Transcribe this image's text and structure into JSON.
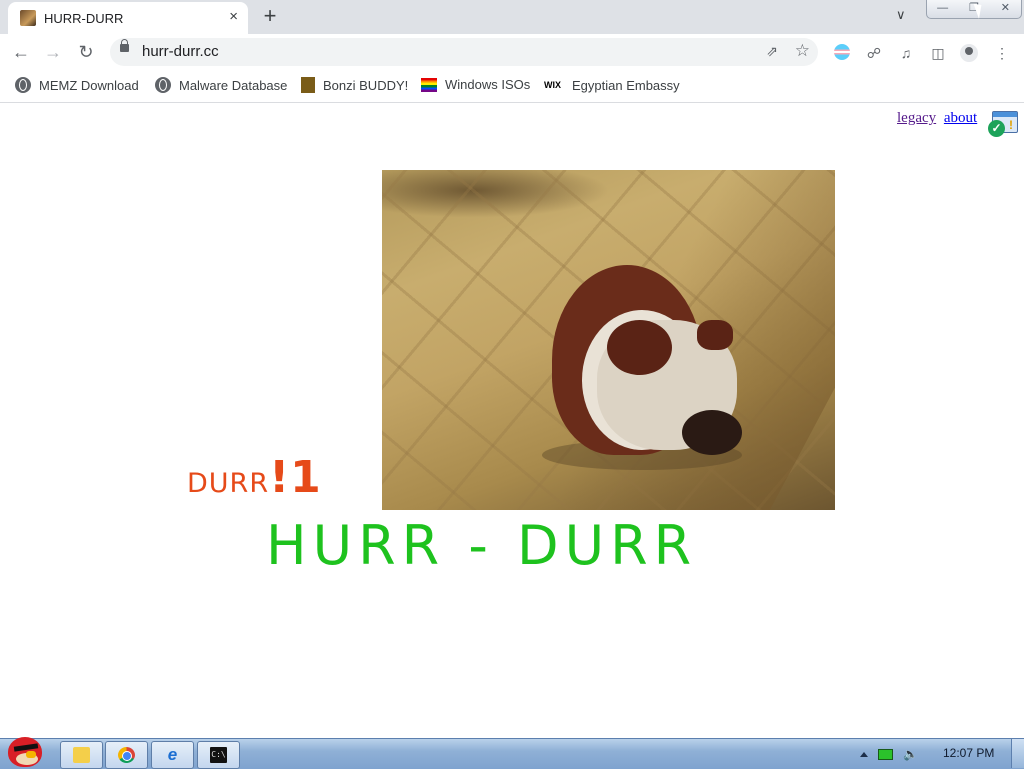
{
  "browser": {
    "tab": {
      "title": "HURR-DURR",
      "close_icon": "×"
    },
    "new_tab_icon": "+",
    "address": {
      "url": "hurr-durr.cc"
    },
    "bookmarks": [
      {
        "label": "MEMZ Download",
        "icon": "globe-icon"
      },
      {
        "label": "Malware Database",
        "icon": "globe-icon"
      },
      {
        "label": "Bonzi BUDDY!",
        "icon": "bonzi-icon"
      },
      {
        "label": "Windows ISOs",
        "icon": "rainbow-flag-icon"
      },
      {
        "label": "Egyptian Embassy",
        "icon": "wix-icon"
      }
    ],
    "wix_text": "WIX"
  },
  "page": {
    "links": {
      "legacy": "legacy",
      "about": "about"
    },
    "durr_small": "DURR",
    "durr_big": "!1",
    "headline": "HURR - DURR"
  },
  "taskbar": {
    "clock": "12:07 PM",
    "apps": [
      "explorer",
      "chrome",
      "internet-explorer",
      "cmd"
    ],
    "cmd_text": "C:\\"
  },
  "colors": {
    "durr": "#e64a19",
    "headline": "#1ec21e",
    "link": "#0000ee"
  }
}
